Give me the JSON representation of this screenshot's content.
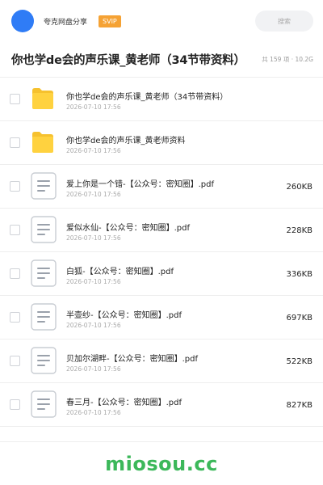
{
  "header": {
    "app_name": "夸克网盘分享",
    "badge": "SVIP",
    "search_placeholder": "搜索",
    "avatar_color": "#2f7cf6",
    "badge_color": "#f5a234"
  },
  "share": {
    "title": "你也学de会的声乐课_黄老师（34节带资料）",
    "meta": "共 159 项 · 10.2G"
  },
  "files": [
    {
      "icon": "folder-icon",
      "name": "你也学de会的声乐课_黄老师（34节带资料）",
      "date": "2026-07-10 17:56",
      "size": ""
    },
    {
      "icon": "folder-icon",
      "name": "你也学de会的声乐课_黄老师资料",
      "date": "2026-07-10 17:56",
      "size": ""
    },
    {
      "icon": "document-icon",
      "name": "爱上你是一个错-【公众号：密知圈】.pdf",
      "date": "2026-07-10 17:56",
      "size": "260KB"
    },
    {
      "icon": "document-icon",
      "name": "爱似水仙-【公众号：密知圈】.pdf",
      "date": "2026-07-10 17:56",
      "size": "228KB"
    },
    {
      "icon": "document-icon",
      "name": "白狐-【公众号：密知圈】.pdf",
      "date": "2026-07-10 17:56",
      "size": "336KB"
    },
    {
      "icon": "document-icon",
      "name": "半壶纱-【公众号：密知圈】.pdf",
      "date": "2026-07-10 17:56",
      "size": "697KB"
    },
    {
      "icon": "document-icon",
      "name": "贝加尔湖畔-【公众号：密知圈】.pdf",
      "date": "2026-07-10 17:56",
      "size": "522KB"
    },
    {
      "icon": "document-icon",
      "name": "春三月-【公众号：密知圈】.pdf",
      "date": "2026-07-10 17:56",
      "size": "827KB"
    }
  ],
  "footer": {
    "watermark": "miosou.cc",
    "watermark_color": "#3cb85a"
  }
}
